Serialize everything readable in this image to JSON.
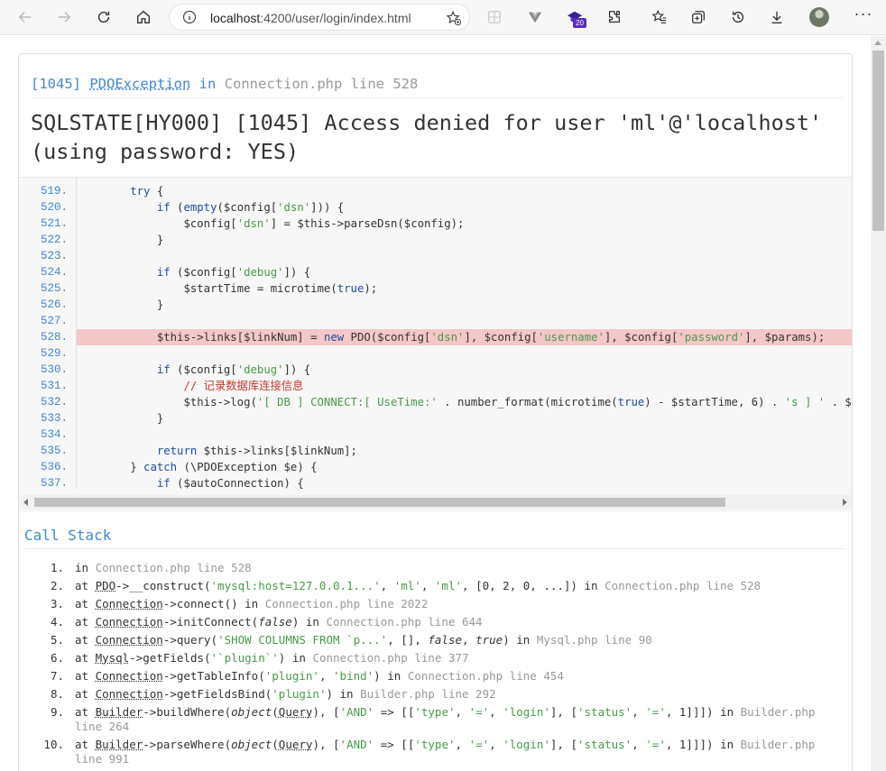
{
  "browser": {
    "url_host": "localhost",
    "url_rest": ":4200/user/login/index.html",
    "extension_badge": "20"
  },
  "exception": {
    "code_label": "[1045]",
    "class_name": "PDOException",
    "in_word": "in",
    "file_location": "Connection.php line 528",
    "message": "SQLSTATE[HY000] [1045] Access denied for user 'ml'@'localhost' (using password: YES)"
  },
  "source": {
    "highlight_line": "528.",
    "line_numbers": [
      "519.",
      "520.",
      "521.",
      "522.",
      "523.",
      "524.",
      "525.",
      "526.",
      "527.",
      "528.",
      "529.",
      "530.",
      "531.",
      "532.",
      "533.",
      "534.",
      "535.",
      "536.",
      "537."
    ],
    "lines": [
      "        try {",
      "            if (empty($config['dsn'])) {",
      "                $config['dsn'] = $this->parseDsn($config);",
      "            }",
      "",
      "            if ($config['debug']) {",
      "                $startTime = microtime(true);",
      "            }",
      "",
      "            $this->links[$linkNum] = new PDO($config['dsn'], $config['username'], $config['password'], $params);",
      "",
      "            if ($config['debug']) {",
      "                // 记录数据库连接信息",
      "                $this->log('[ DB ] CONNECT:[ UseTime:' . number_format(microtime(true) - $startTime, 6) . 's ] ' . $config['dsn']);",
      "            }",
      "",
      "            return $this->links[$linkNum];",
      "        } catch (\\PDOException $e) {",
      "            if ($autoConnection) {"
    ]
  },
  "call_stack": {
    "title": "Call Stack",
    "frames": [
      {
        "num": "1.",
        "text": "in Connection.php line 528"
      },
      {
        "num": "2.",
        "text": "at PDO->__construct('mysql:host=127.0.0.1...', 'ml', 'ml', [0, 2, 0, ...]) in Connection.php line 528"
      },
      {
        "num": "3.",
        "text": "at Connection->connect() in Connection.php line 2022"
      },
      {
        "num": "4.",
        "text": "at Connection->initConnect(false) in Connection.php line 644"
      },
      {
        "num": "5.",
        "text": "at Connection->query('SHOW COLUMNS FROM `p...', [], false, true) in Mysql.php line 90"
      },
      {
        "num": "6.",
        "text": "at Mysql->getFields('`plugin`') in Connection.php line 377"
      },
      {
        "num": "7.",
        "text": "at Connection->getTableInfo('plugin', 'bind') in Connection.php line 454"
      },
      {
        "num": "8.",
        "text": "at Connection->getFieldsBind('plugin') in Builder.php line 292"
      },
      {
        "num": "9.",
        "text": "at Builder->buildWhere(object(Query), ['AND' => [['type', '=', 'login'], ['status', '=', 1]]]) in Builder.php line 264"
      },
      {
        "num": "10.",
        "text": "at Builder->parseWhere(object(Query), ['AND' => [['type', '=', 'login'], ['status', '=', 1]]]) in Builder.php line 991"
      }
    ]
  },
  "colors": {
    "accent": "#4288ce",
    "highlight": "#f4c7c8",
    "muted": "#999999"
  }
}
